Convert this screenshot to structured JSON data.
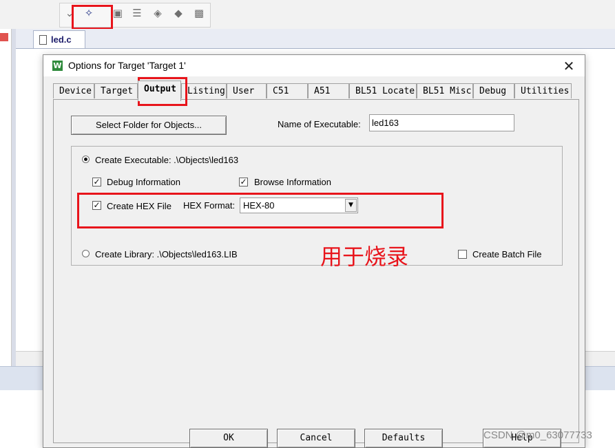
{
  "ide": {
    "toolbar_icons": [
      "options-for-target-icon",
      "download-icon",
      "batch-icon",
      "manage-components-icon",
      "select-packs-icon",
      "pack-installer-icon"
    ],
    "file_tab": "led.c"
  },
  "dialog": {
    "title": "Options for Target 'Target 1'",
    "title_icon": "W",
    "close": "✕",
    "tabs": [
      {
        "label": "Device"
      },
      {
        "label": "Target"
      },
      {
        "label": "Output"
      },
      {
        "label": "Listing"
      },
      {
        "label": "User"
      },
      {
        "label": "C51"
      },
      {
        "label": "A51"
      },
      {
        "label": "BL51 Locate"
      },
      {
        "label": "BL51 Misc"
      },
      {
        "label": "Debug"
      },
      {
        "label": "Utilities"
      }
    ],
    "active_tab": "Output",
    "output": {
      "select_folder_label": "Select Folder for Objects...",
      "name_exe_label": "Name of Executable:",
      "name_exe_value": "led163",
      "create_exe_label": "Create Executable:  .\\Objects\\led163",
      "create_exe_selected": true,
      "debug_info_label": "Debug Information",
      "debug_info_checked": true,
      "browse_info_label": "Browse Information",
      "browse_info_checked": true,
      "create_hex_label": "Create HEX File",
      "create_hex_checked": true,
      "hex_format_label": "HEX Format:",
      "hex_format_value": "HEX-80",
      "create_lib_label": "Create Library:  .\\Objects\\led163.LIB",
      "create_lib_selected": false,
      "batch_label": "Create Batch File",
      "batch_checked": false
    },
    "annotation": "用于烧录",
    "buttons": {
      "ok": "OK",
      "cancel": "Cancel",
      "defaults": "Defaults",
      "help": "Help"
    }
  },
  "watermark": "CSDN @m0_63077733",
  "colors": {
    "highlight_red": "#e8141b",
    "dialog_bg": "#f0f0f0",
    "title_icon_green": "#2f8a3c"
  }
}
